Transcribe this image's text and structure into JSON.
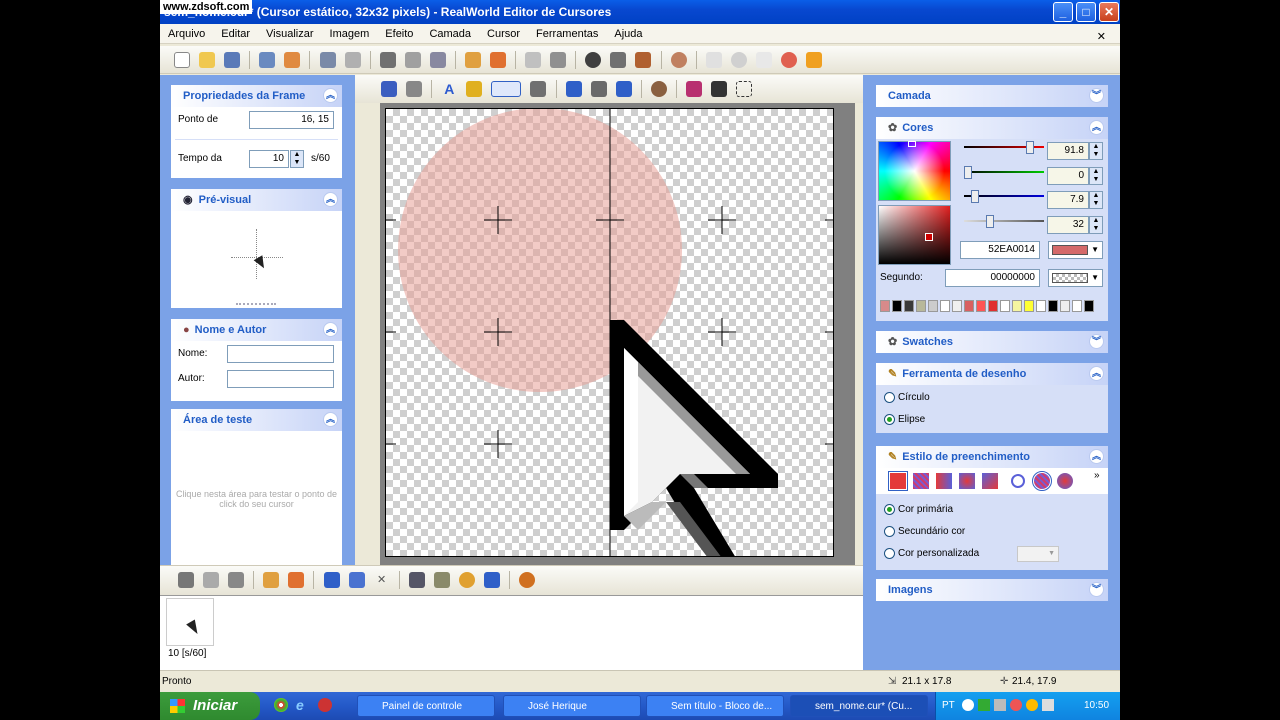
{
  "watermark": "www.zdsoft.com",
  "window": {
    "title": "sem_nome.cur* (Cursor estático, 32x32 pixels) - RealWorld Editor de Cursores"
  },
  "menu": [
    "Arquivo",
    "Editar",
    "Visualizar",
    "Imagem",
    "Efeito",
    "Camada",
    "Cursor",
    "Ferramentas",
    "Ajuda"
  ],
  "left": {
    "frame_props": {
      "title": "Propriedades da Frame",
      "point_label": "Ponto de",
      "point_value": "16, 15",
      "time_label": "Tempo da",
      "time_value": "10",
      "time_unit": "s/60"
    },
    "preview": {
      "title": "Pré-visual"
    },
    "name_author": {
      "title": "Nome e Autor",
      "name_label": "Nome:",
      "author_label": "Autor:"
    },
    "test_area": {
      "title": "Área de teste",
      "hint": "Clique nesta área para testar o ponto de click do seu cursor"
    }
  },
  "right": {
    "layer": {
      "title": "Camada"
    },
    "colors": {
      "title": "Cores",
      "slider_values": [
        "91.8",
        "0",
        "7.9",
        "32"
      ],
      "hex_primary": "52EA0014",
      "second_label": "Segundo:",
      "hex_second": "00000000",
      "palette": [
        "#d88a8a",
        "#000000",
        "#3a3a3a",
        "#b8b89a",
        "#cccccc",
        "#ffffff",
        "#f0f0f0",
        "#d96060",
        "#ff5555",
        "#e03030",
        "#ffffff",
        "#f5f5a0",
        "#ffff33",
        "#ffffff",
        "#000000",
        "#eeeeee",
        "#ffffff",
        "#000000"
      ]
    },
    "swatches": {
      "title": "Swatches"
    },
    "draw_tool": {
      "title": "Ferramenta de desenho",
      "options": [
        "Círculo",
        "Elipse"
      ],
      "selected": 1
    },
    "fill_style": {
      "title": "Estilo de preenchimento",
      "options": [
        "Cor primária",
        "Secundário cor",
        "Cor personalizada"
      ],
      "selected": 0
    },
    "images": {
      "title": "Imagens"
    }
  },
  "frames": {
    "frame_label": "10 [s/60]"
  },
  "status": {
    "text": "Pronto",
    "size": "21.1 x 17.8",
    "pos": "21.4, 17.9"
  },
  "taskbar": {
    "start": "Iniciar",
    "tasks": [
      "Painel de controle",
      "José Herique",
      "Sem título - Bloco de...",
      "sem_nome.cur* (Cu..."
    ],
    "lang": "PT",
    "clock": "10:50"
  }
}
